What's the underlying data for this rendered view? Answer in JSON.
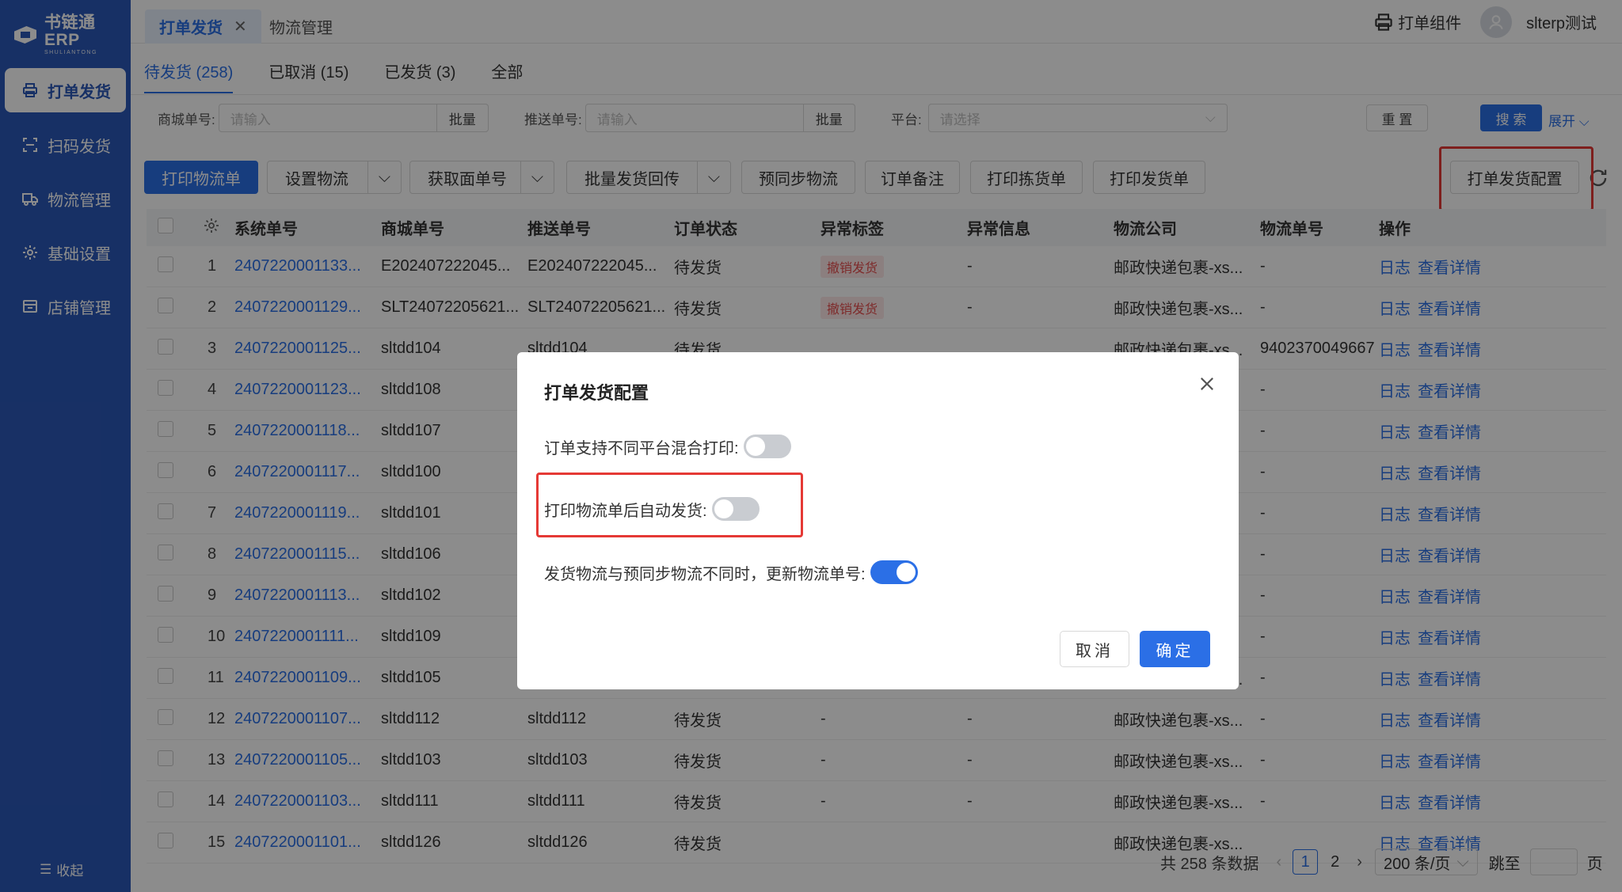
{
  "brand": {
    "name": "书链通ERP",
    "sub": "SHULIANTONG"
  },
  "sidebar": {
    "items": [
      {
        "label": "打单发货",
        "icon": "printer-icon",
        "active": true
      },
      {
        "label": "扫码发货",
        "icon": "scan-icon",
        "active": false
      },
      {
        "label": "物流管理",
        "icon": "truck-icon",
        "active": false
      },
      {
        "label": "基础设置",
        "icon": "gear-icon",
        "active": false
      },
      {
        "label": "店铺管理",
        "icon": "store-icon",
        "active": false
      }
    ],
    "collapse_label": "收起"
  },
  "topbar": {
    "tabs": [
      {
        "label": "打单发货",
        "active": true
      },
      {
        "label": "物流管理",
        "active": false
      }
    ],
    "print_component": "打单组件",
    "user": "slterp测试"
  },
  "status_tabs": [
    {
      "label": "待发货 (258)",
      "active": true
    },
    {
      "label": "已取消 (15)",
      "active": false
    },
    {
      "label": "已发货 (3)",
      "active": false
    },
    {
      "label": "全部",
      "active": false
    }
  ],
  "filters": {
    "mall_no_label": "商城单号:",
    "mall_no_placeholder": "请输入",
    "push_no_label": "推送单号:",
    "push_no_placeholder": "请输入",
    "batch_label": "批量",
    "platform_label": "平台:",
    "platform_placeholder": "请选择",
    "reset": "重 置",
    "search": "搜 索",
    "expand": "展开"
  },
  "toolbar": {
    "print_logistics": "打印物流单",
    "set_logistics": "设置物流",
    "get_waybill": "获取面单号",
    "batch_ship_back": "批量发货回传",
    "pre_sync": "预同步物流",
    "order_note": "订单备注",
    "print_pick": "打印拣货单",
    "print_ship": "打印发货单",
    "config": "打单发货配置"
  },
  "table": {
    "headers": [
      "系统单号",
      "商城单号",
      "推送单号",
      "订单状态",
      "异常标签",
      "异常信息",
      "物流公司",
      "物流单号",
      "操作"
    ],
    "rows": [
      {
        "idx": "1",
        "sys": "2407220001133...",
        "mall": "E202407222045...",
        "push": "E202407222045...",
        "status": "待发货",
        "tag": "撤销发货",
        "info": "-",
        "company": "邮政快递包裹-xs...",
        "waybill": "-"
      },
      {
        "idx": "2",
        "sys": "2407220001129...",
        "mall": "SLT24072205621...",
        "push": "SLT24072205621...",
        "status": "待发货",
        "tag": "撤销发货",
        "info": "-",
        "company": "邮政快递包裹-xs...",
        "waybill": "-"
      },
      {
        "idx": "3",
        "sys": "2407220001125...",
        "mall": "sltdd104",
        "push": "sltdd104",
        "status": "待发货",
        "tag": "",
        "info": "",
        "company": "邮政快递包裹-xs...",
        "waybill": "9402370049667"
      },
      {
        "idx": "4",
        "sys": "2407220001123...",
        "mall": "sltdd108",
        "push": "",
        "status": "",
        "tag": "",
        "info": "",
        "company": "s...",
        "waybill": "-"
      },
      {
        "idx": "5",
        "sys": "2407220001118...",
        "mall": "sltdd107",
        "push": "",
        "status": "",
        "tag": "",
        "info": "",
        "company": "s...",
        "waybill": "-"
      },
      {
        "idx": "6",
        "sys": "2407220001117...",
        "mall": "sltdd100",
        "push": "",
        "status": "",
        "tag": "",
        "info": "",
        "company": "s...",
        "waybill": "-"
      },
      {
        "idx": "7",
        "sys": "2407220001119...",
        "mall": "sltdd101",
        "push": "",
        "status": "",
        "tag": "",
        "info": "",
        "company": "s...",
        "waybill": "-"
      },
      {
        "idx": "8",
        "sys": "2407220001115...",
        "mall": "sltdd106",
        "push": "",
        "status": "",
        "tag": "",
        "info": "",
        "company": "s...",
        "waybill": "-"
      },
      {
        "idx": "9",
        "sys": "2407220001113...",
        "mall": "sltdd102",
        "push": "",
        "status": "",
        "tag": "",
        "info": "",
        "company": "s...",
        "waybill": "-"
      },
      {
        "idx": "10",
        "sys": "2407220001111...",
        "mall": "sltdd109",
        "push": "",
        "status": "",
        "tag": "",
        "info": "",
        "company": "s...",
        "waybill": "-"
      },
      {
        "idx": "11",
        "sys": "2407220001109...",
        "mall": "sltdd105",
        "push": "sltdd105",
        "status": "待发货",
        "tag": "",
        "info": "",
        "company": "邮政快递包裹-xs...",
        "waybill": "-"
      },
      {
        "idx": "12",
        "sys": "2407220001107...",
        "mall": "sltdd112",
        "push": "sltdd112",
        "status": "待发货",
        "tag": "-",
        "info": "-",
        "company": "邮政快递包裹-xs...",
        "waybill": "-"
      },
      {
        "idx": "13",
        "sys": "2407220001105...",
        "mall": "sltdd103",
        "push": "sltdd103",
        "status": "待发货",
        "tag": "-",
        "info": "-",
        "company": "邮政快递包裹-xs...",
        "waybill": "-"
      },
      {
        "idx": "14",
        "sys": "2407220001103...",
        "mall": "sltdd111",
        "push": "sltdd111",
        "status": "待发货",
        "tag": "-",
        "info": "-",
        "company": "邮政快递包裹-xs...",
        "waybill": "-"
      },
      {
        "idx": "15",
        "sys": "2407220001101...",
        "mall": "sltdd126",
        "push": "sltdd126",
        "status": "待发货",
        "tag": "",
        "info": "",
        "company": "邮政快递包裹-xs...",
        "waybill": ""
      }
    ],
    "action_log": "日志",
    "action_detail": "查看详情"
  },
  "pagination": {
    "total": "共 258 条数据",
    "pages": [
      "1",
      "2"
    ],
    "current": "1",
    "page_size": "200 条/页",
    "jump_label": "跳至",
    "page_suffix": "页"
  },
  "modal": {
    "title": "打单发货配置",
    "options": [
      {
        "label": "订单支持不同平台混合打印:",
        "on": false
      },
      {
        "label": "打印物流单后自动发货:",
        "on": false
      },
      {
        "label": "发货物流与预同步物流不同时，更新物流单号:",
        "on": true
      }
    ],
    "cancel": "取消",
    "confirm": "确定"
  },
  "colors": {
    "primary": "#2b6fe6",
    "sidebar": "#2b58b8",
    "highlight": "#e53935"
  }
}
